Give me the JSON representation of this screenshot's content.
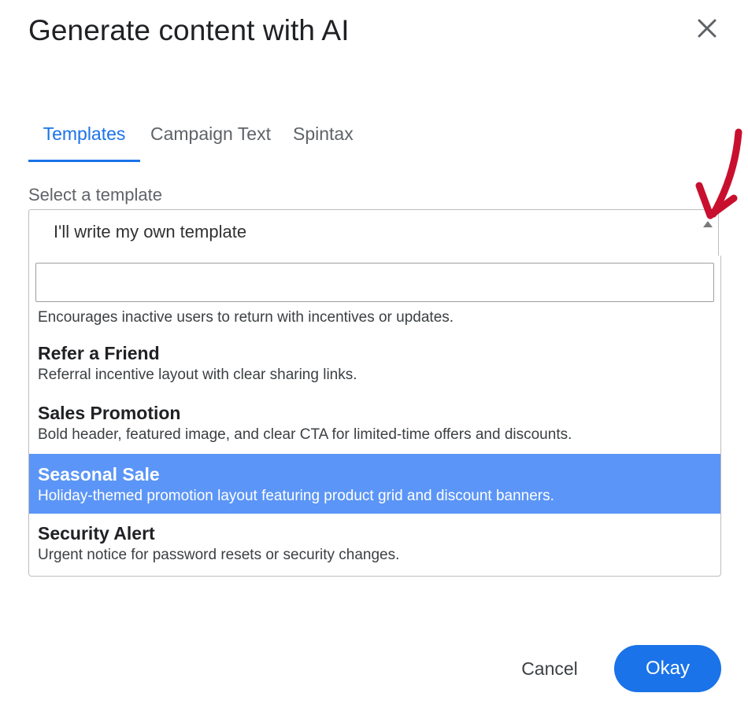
{
  "dialog": {
    "title": "Generate content with AI"
  },
  "close_icon": "close-icon",
  "tabs": [
    {
      "label": "Templates",
      "active": true
    },
    {
      "label": "Campaign Text",
      "active": false
    },
    {
      "label": "Spintax",
      "active": false
    }
  ],
  "select": {
    "label": "Select a template",
    "value": "I'll write my own template",
    "search_value": "",
    "search_placeholder": "",
    "partial_option_description": "Encourages inactive users to return with incentives or updates.",
    "options": [
      {
        "title": "Refer a Friend",
        "description": "Referral incentive layout with clear sharing links.",
        "highlighted": false
      },
      {
        "title": "Sales Promotion",
        "description": "Bold header, featured image, and clear CTA for limited-time offers and discounts.",
        "highlighted": false
      },
      {
        "title": "Seasonal Sale",
        "description": "Holiday-themed promotion layout featuring product grid and discount banners.",
        "highlighted": true
      },
      {
        "title": "Security Alert",
        "description": "Urgent notice for password resets or security changes.",
        "highlighted": false
      }
    ]
  },
  "footer": {
    "cancel_label": "Cancel",
    "okay_label": "Okay"
  },
  "colors": {
    "accent": "#1a73e8",
    "highlight": "#5b95f7",
    "annotation_arrow": "#c8102e"
  }
}
